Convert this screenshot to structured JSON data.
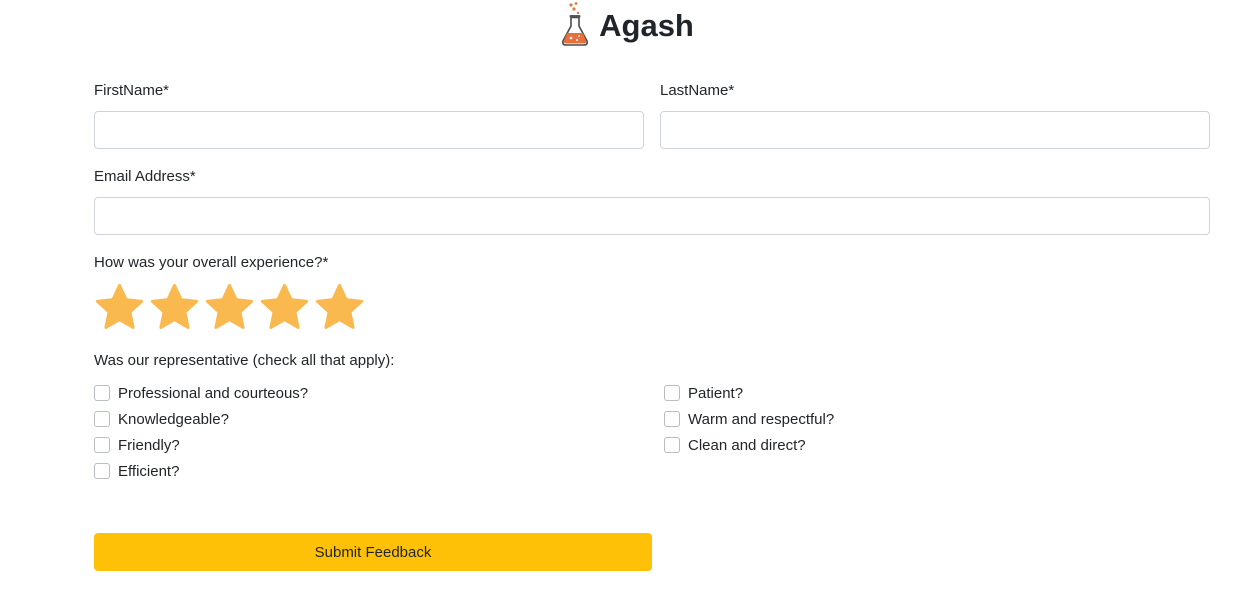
{
  "brand": {
    "name": "Agash",
    "icon": "flask-icon"
  },
  "form": {
    "first_name": {
      "label": "FirstName*",
      "value": "",
      "placeholder": ""
    },
    "last_name": {
      "label": "LastName*",
      "value": "",
      "placeholder": ""
    },
    "email": {
      "label": "Email Address*",
      "value": "",
      "placeholder": ""
    },
    "experience": {
      "label": "How was your overall experience?*",
      "max_stars": 5,
      "filled_stars": 5,
      "star_icon": "star-icon",
      "star_color": "#f9b94f"
    },
    "representative": {
      "label": "Was our representative (check all that apply):",
      "left_options": [
        {
          "label": "Professional and courteous?",
          "checked": false
        },
        {
          "label": "Knowledgeable?",
          "checked": false
        },
        {
          "label": "Friendly?",
          "checked": false
        },
        {
          "label": "Efficient?",
          "checked": false
        }
      ],
      "right_options": [
        {
          "label": "Patient?",
          "checked": false
        },
        {
          "label": "Warm and respectful?",
          "checked": false
        },
        {
          "label": "Clean and direct?",
          "checked": false
        }
      ]
    },
    "submit_label": "Submit Feedback"
  },
  "colors": {
    "submit_bg": "#ffc107",
    "field_border": "#ced4da",
    "text": "#212529"
  }
}
